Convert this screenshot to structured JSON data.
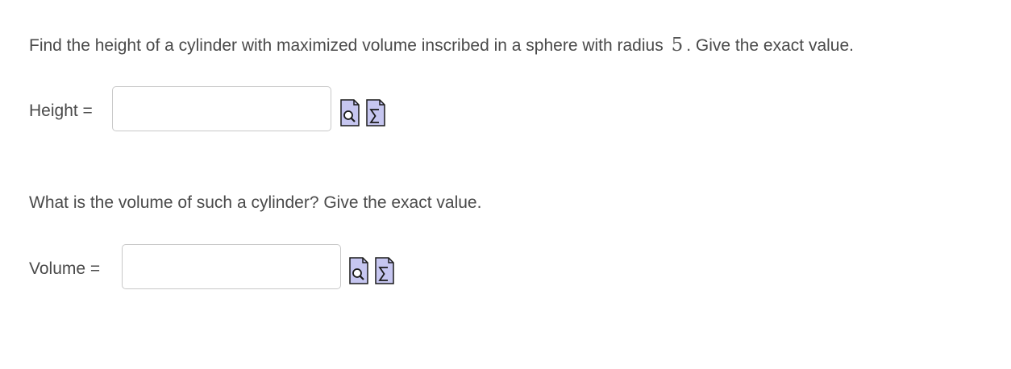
{
  "question1": {
    "text_before": "Find the height of a cylinder with maximized volume inscribed in a sphere with radius",
    "radius": "5",
    "text_after": ". Give the exact value."
  },
  "height": {
    "label": "Height =",
    "value": "",
    "preview_icon": "preview-icon",
    "equation_icon": "equation-editor-icon"
  },
  "question2": {
    "text": "What is the volume of such a cylinder? Give the exact value."
  },
  "volume": {
    "label": "Volume =",
    "value": "",
    "preview_icon": "preview-icon",
    "equation_icon": "equation-editor-icon"
  },
  "colors": {
    "text": "#4a4a4a",
    "input_border": "#c8c8c8",
    "icon_fill": "#c6c6f0",
    "icon_stroke": "#1a1a1a"
  }
}
